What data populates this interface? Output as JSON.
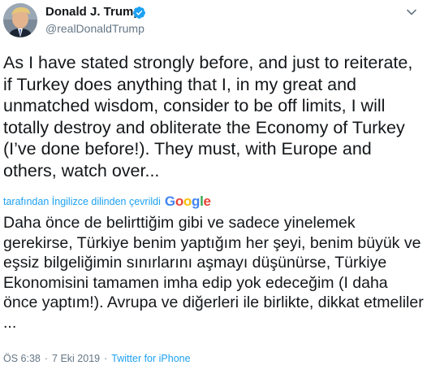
{
  "author": {
    "display_name": "Donald J. Trump",
    "handle": "@realDonaldTrump",
    "verified": true,
    "avatar_icon": "profile-photo",
    "verified_icon": "verified-badge-icon"
  },
  "tweet": {
    "text": "As I have stated strongly before, and just to reiterate, if Turkey does anything that I, in my great and unmatched wisdom, consider to be off limits, I will totally destroy and obliterate the Economy of Turkey (I’ve done before!). They must, with Europe and others, watch over...",
    "translation": {
      "translated_by_label": "tarafından İngilizce dilinden çevrildi",
      "provider": "Google",
      "text": "Daha önce de belirttiğim gibi ve sadece yinelemek gerekirse, Türkiye benim yaptığım her şeyi, benim büyük ve eşsiz bilgeliğimin sınırlarını aşmayı düşünürse, Türkiye Ekonomisini tamamen imha edip yok edeceğim (I daha önce yaptım!). Avrupa ve diğerleri ile birlikte, dikkat etmeliler ..."
    },
    "time": "ÖS 6:38",
    "date": "7 Eki 2019",
    "separator": "·",
    "source": "Twitter for iPhone"
  },
  "colors": {
    "link": "#1da1f2",
    "secondary_text": "#657786",
    "primary_text": "#14171a",
    "verified": "#1da1f2"
  },
  "icons": {
    "menu": "chevron-down-icon"
  }
}
